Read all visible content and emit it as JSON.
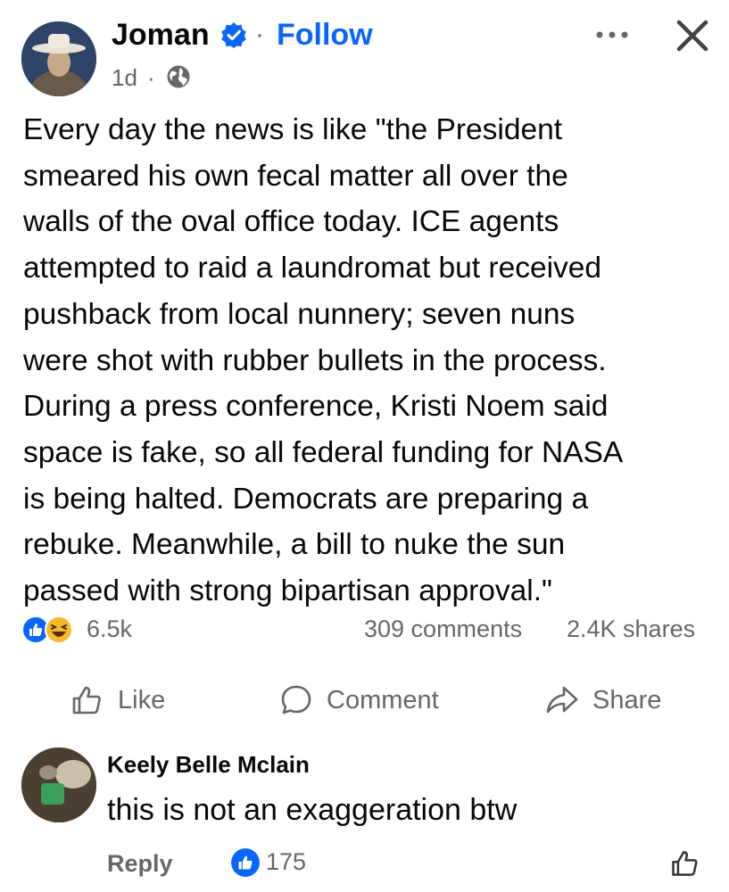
{
  "post": {
    "author": "Joman",
    "verified_icon": "verified-badge-icon",
    "separator": "·",
    "follow_label": "Follow",
    "time": "1d",
    "time_separator": "·",
    "audience_icon": "globe-icon",
    "text": "Every day the news is like \"the President\nsmeared his own fecal matter all over the\nwalls of the oval office today. ICE agents\nattempted to raid a laundromat but received\npushback from local nunnery; seven nuns\nwere shot with rubber bullets in the process.\nDuring a press conference, Kristi Noem said\nspace is fake, so all federal funding for NASA\nis being halted. Democrats are preparing a\nrebuke. Meanwhile, a bill to nuke the sun\npassed with strong bipartisan approval.\""
  },
  "stats": {
    "reactions": "6.5k",
    "comments": "309 comments",
    "shares": "2.4K shares"
  },
  "actions": {
    "like": "Like",
    "comment": "Comment",
    "share": "Share"
  },
  "comment": {
    "author": "Keely Belle Mclain",
    "text": "this is not an exaggeration btw",
    "reply_label": "Reply",
    "likes": "175"
  },
  "colors": {
    "accent": "#0866ff",
    "secondary_text": "#65676b",
    "haha": "#f7b928"
  }
}
